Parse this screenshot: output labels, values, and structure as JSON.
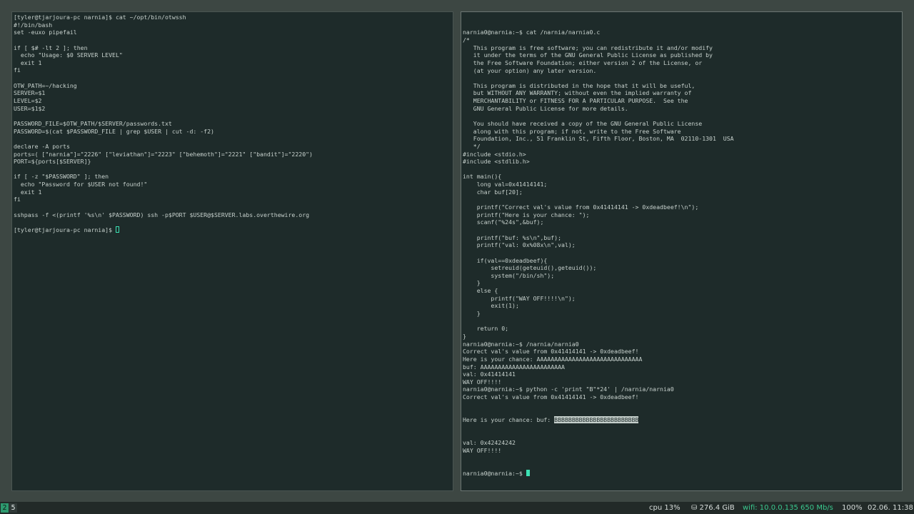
{
  "left_terminal": {
    "lines": [
      "[tyler@tjarjoura-pc narnia]$ cat ~/opt/bin/otwssh",
      "#!/bin/bash",
      "set -euxo pipefail",
      "",
      "if [ $# -lt 2 ]; then",
      "  echo \"Usage: $0 SERVER LEVEL\"",
      "  exit 1",
      "fi",
      "",
      "OTW_PATH=~/hacking",
      "SERVER=$1",
      "LEVEL=$2",
      "USER=$1$2",
      "",
      "PASSWORD_FILE=$OTW_PATH/$SERVER/passwords.txt",
      "PASSWORD=$(cat $PASSWORD_FILE | grep $USER | cut -d: -f2)",
      "",
      "declare -A ports",
      "ports=( [\"narnia\"]=\"2226\" [\"leviathan\"]=\"2223\" [\"behemoth\"]=\"2221\" [\"bandit\"]=\"2220\")",
      "PORT=${ports[$SERVER]}",
      "",
      "if [ -z \"$PASSWORD\" ]; then",
      "  echo \"Password for $USER not found!\"",
      "  exit 1",
      "fi",
      "",
      "sshpass -f <(printf '%s\\n' $PASSWORD) ssh -p$PORT $USER@$SERVER.labs.overthewire.org",
      ""
    ],
    "prompt": "[tyler@tjarjoura-pc narnia]$ "
  },
  "right_terminal": {
    "lines": [
      "narnia0@narnia:~$ cat /narnia/narnia0.c",
      "/*",
      "   This program is free software; you can redistribute it and/or modify",
      "   it under the terms of the GNU General Public License as published by",
      "   the Free Software Foundation; either version 2 of the License, or",
      "   (at your option) any later version.",
      "",
      "   This program is distributed in the hope that it will be useful,",
      "   but WITHOUT ANY WARRANTY; without even the implied warranty of",
      "   MERCHANTABILITY or FITNESS FOR A PARTICULAR PURPOSE.  See the",
      "   GNU General Public License for more details.",
      "",
      "   You should have received a copy of the GNU General Public License",
      "   along with this program; if not, write to the Free Software",
      "   Foundation, Inc., 51 Franklin St, Fifth Floor, Boston, MA  02110-1301  USA",
      "   */",
      "#include <stdio.h>",
      "#include <stdlib.h>",
      "",
      "int main(){",
      "    long val=0x41414141;",
      "    char buf[20];",
      "",
      "    printf(\"Correct val's value from 0x41414141 -> 0xdeadbeef!\\n\");",
      "    printf(\"Here is your chance: \");",
      "    scanf(\"%24s\",&buf);",
      "",
      "    printf(\"buf: %s\\n\",buf);",
      "    printf(\"val: 0x%08x\\n\",val);",
      "",
      "    if(val==0xdeadbeef){",
      "        setreuid(geteuid(),geteuid());",
      "        system(\"/bin/sh\");",
      "    }",
      "    else {",
      "        printf(\"WAY OFF!!!!\\n\");",
      "        exit(1);",
      "    }",
      "",
      "    return 0;",
      "}",
      "narnia0@narnia:~$ /narnia/narnia0",
      "Correct val's value from 0x41414141 -> 0xdeadbeef!",
      "Here is your chance: AAAAAAAAAAAAAAAAAAAAAAAAAAAAAA",
      "buf: AAAAAAAAAAAAAAAAAAAAAAAA",
      "val: 0x41414141",
      "WAY OFF!!!!",
      "narnia0@narnia:~$ python -c 'print \"B\"*24' | /narnia/narnia0",
      "Correct val's value from 0x41414141 -> 0xdeadbeef!"
    ],
    "selection_prefix": "Here is your chance: buf: ",
    "selection_text": "BBBBBBBBBBBBBBBBBBBBBBBB",
    "after_selection": [
      "val: 0x42424242",
      "WAY OFF!!!!"
    ],
    "prompt": "narnia0@narnia:~$ "
  },
  "statusbar": {
    "workspaces": [
      {
        "label": "2",
        "active": false
      },
      {
        "label": "5",
        "active": true
      }
    ],
    "cpu": "cpu  13%",
    "disk": "⛁ 276.4 GiB",
    "wifi": "wifi: 10.0.0.135 650 Mb/s",
    "volume": "100%",
    "clock": "02.06. 11:38"
  },
  "colors": {
    "terminal_bg": "#1e2b2a",
    "terminal_fg": "#c6d0cc",
    "cursor": "#3ce3b4",
    "wifi": "#3ac98f",
    "workspace_inactive": "#2e9a6f"
  }
}
